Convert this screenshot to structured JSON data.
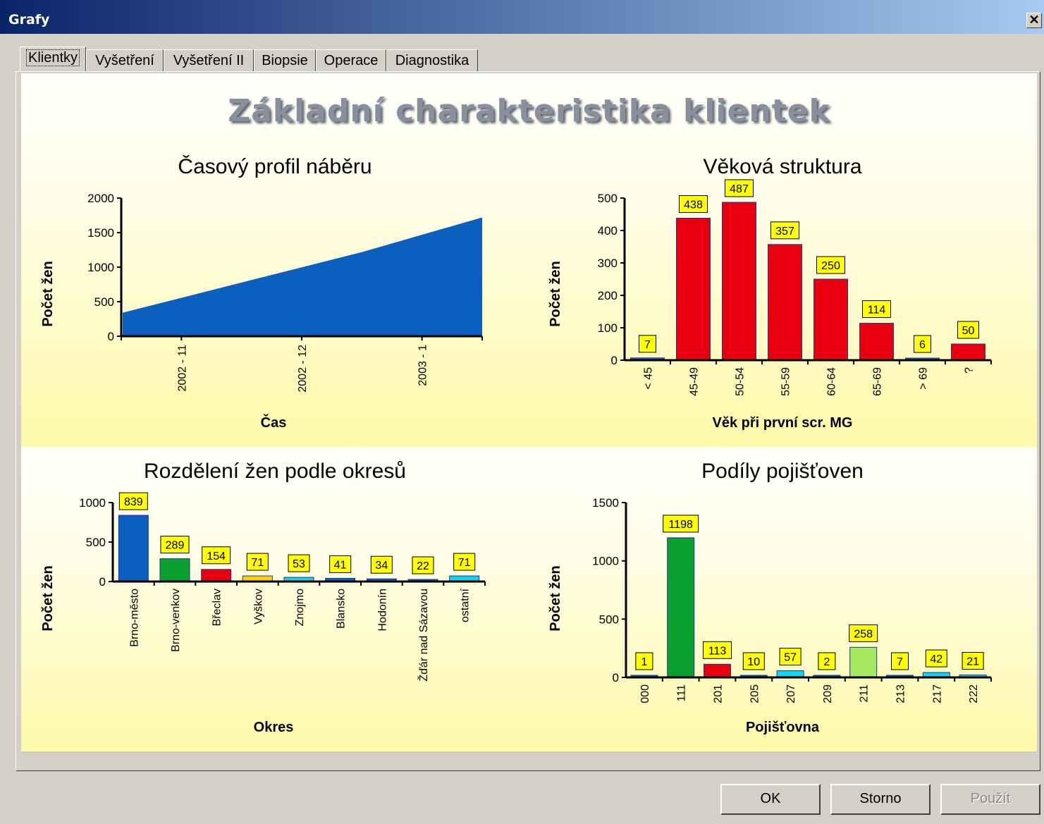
{
  "window": {
    "title": "Grafy",
    "close_label": "✕"
  },
  "tabs": [
    "Klientky",
    "Vyšetření",
    "Vyšetření II",
    "Biopsie",
    "Operace",
    "Diagnostika"
  ],
  "banner": "Základní charakteristika klientek",
  "buttons": {
    "ok": "OK",
    "cancel": "Storno",
    "apply": "Použít"
  },
  "colors": {
    "blue": "#0a5fbf",
    "red": "#e8000e",
    "green": "#0aa030",
    "yellow": "#ffd300",
    "cyan": "#14d2f0",
    "light_green": "#a6e860",
    "label_bg": "#ffff00"
  },
  "chart_data": [
    {
      "id": "time",
      "type": "area",
      "title": "Časový profil náběru",
      "xlabel": "Čas",
      "ylabel": "Počet žen",
      "ylim": [
        0,
        2000
      ],
      "yticks": [
        0,
        500,
        1000,
        1500,
        2000
      ],
      "xticks": [
        "2002 - 11",
        "2002 - 12",
        "2003 - 1"
      ],
      "series": [
        {
          "x": [
            0,
            1,
            2,
            3
          ],
          "values": [
            340,
            780,
            1220,
            1720
          ]
        }
      ]
    },
    {
      "id": "age",
      "type": "bar",
      "title": "Věková struktura",
      "xlabel": "Věk při první scr. MG",
      "ylabel": "Počet žen",
      "ylim": [
        0,
        500
      ],
      "yticks": [
        0,
        100,
        200,
        300,
        400,
        500
      ],
      "categories": [
        "< 45",
        "45-49",
        "50-54",
        "55-59",
        "60-64",
        "65-69",
        "> 69",
        "?"
      ],
      "values": [
        7,
        438,
        487,
        357,
        250,
        114,
        6,
        50
      ],
      "colors": [
        "#0a5fbf",
        "#e8000e",
        "#e8000e",
        "#e8000e",
        "#e8000e",
        "#e8000e",
        "#0a5fbf",
        "#e8000e"
      ]
    },
    {
      "id": "district",
      "type": "bar",
      "title": "Rozdělení žen podle okresů",
      "xlabel": "Okres",
      "ylabel": "Počet žen",
      "ylim": [
        0,
        1000
      ],
      "yticks": [
        0,
        500,
        1000
      ],
      "categories": [
        "Brno-město",
        "Brno-venkov",
        "Břeclav",
        "Vyškov",
        "Znojmo",
        "Blansko",
        "Hodonín",
        "Žďár nad Sázavou",
        "ostatní"
      ],
      "values": [
        839,
        289,
        154,
        71,
        53,
        41,
        34,
        22,
        71
      ],
      "colors": [
        "#0a5fbf",
        "#0aa030",
        "#e8000e",
        "#ffd300",
        "#14d2f0",
        "#0a5fbf",
        "#0a5fbf",
        "#0a5fbf",
        "#14d2f0"
      ]
    },
    {
      "id": "insurance",
      "type": "bar",
      "title": "Podíly pojišťoven",
      "xlabel": "Pojišťovna",
      "ylabel": "Počet žen",
      "ylim": [
        0,
        1500
      ],
      "yticks": [
        0,
        500,
        1000,
        1500
      ],
      "categories": [
        "000",
        "111",
        "201",
        "205",
        "207",
        "209",
        "211",
        "213",
        "217",
        "222"
      ],
      "values": [
        1,
        1198,
        113,
        10,
        57,
        2,
        258,
        7,
        42,
        21
      ],
      "colors": [
        "#0a5fbf",
        "#0aa030",
        "#e8000e",
        "#0a5fbf",
        "#14d2f0",
        "#0a5fbf",
        "#a6e860",
        "#0a5fbf",
        "#14d2f0",
        "#14d2f0"
      ]
    }
  ]
}
